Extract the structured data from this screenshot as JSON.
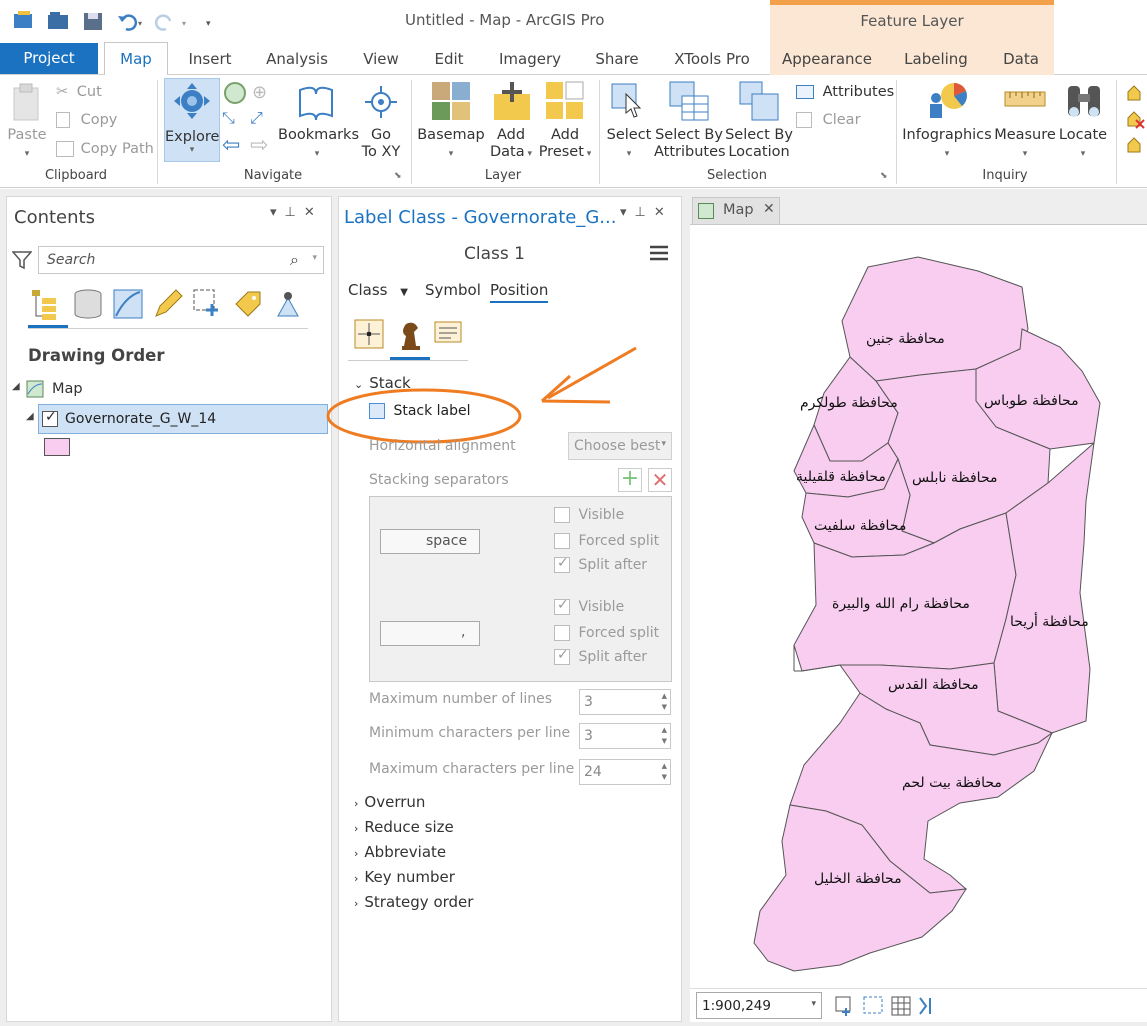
{
  "window": {
    "title": "Untitled - Map - ArcGIS Pro",
    "contextual_header": "Feature Layer"
  },
  "tabs": [
    "Project",
    "Map",
    "Insert",
    "Analysis",
    "View",
    "Edit",
    "Imagery",
    "Share",
    "XTools Pro",
    "Appearance",
    "Labeling",
    "Data"
  ],
  "ribbon": {
    "clipboard": {
      "paste": "Paste",
      "cut": "Cut",
      "copy": "Copy",
      "copy_path": "Copy Path",
      "group": "Clipboard"
    },
    "navigate": {
      "explore": "Explore",
      "bookmarks": "Bookmarks",
      "go_to_xy_1": "Go",
      "go_to_xy_2": "To XY",
      "group": "Navigate"
    },
    "layer": {
      "basemap": "Basemap",
      "add_data_1": "Add",
      "add_data_2": "Data",
      "add_preset_1": "Add",
      "add_preset_2": "Preset",
      "group": "Layer"
    },
    "selection": {
      "select": "Select",
      "by_attr_1": "Select By",
      "by_attr_2": "Attributes",
      "by_loc_1": "Select By",
      "by_loc_2": "Location",
      "attributes": "Attributes",
      "clear": "Clear",
      "group": "Selection"
    },
    "inquiry": {
      "infographics": "Infographics",
      "measure": "Measure",
      "locate": "Locate",
      "group": "Inquiry"
    }
  },
  "contents": {
    "title": "Contents",
    "search_placeholder": "Search",
    "drawing_order": "Drawing Order",
    "map_name": "Map",
    "layer_name": "Governorate_G_W_14"
  },
  "label_class": {
    "title": "Label Class - Governorate_G...",
    "class_name": "Class 1",
    "tabs": [
      "Class",
      "Symbol",
      "Position"
    ],
    "stack_section": "Stack",
    "stack_label": "Stack label",
    "horizontal_alignment": "Horizontal alignment",
    "alignment_value": "Choose best",
    "stacking_separators": "Stacking separators",
    "sep1_value": "space",
    "sep2_value": ",",
    "visible": "Visible",
    "forced_split": "Forced split",
    "split_after": "Split after",
    "max_lines_label": "Maximum number of lines",
    "max_lines": "3",
    "min_chars_label": "Minimum characters per line",
    "min_chars": "3",
    "max_chars_label": "Maximum characters per line",
    "max_chars": "24",
    "collapsed_sections": [
      "Overrun",
      "Reduce size",
      "Abbreviate",
      "Key number",
      "Strategy order"
    ]
  },
  "map": {
    "tab": "Map",
    "scale": "1:900,249",
    "labels": {
      "jenin": "محافظة جنين",
      "tubas": "محافظة طوباس",
      "tulkarm": "محافظة طولكرم",
      "qalqilya": "محافظة قلقيلية",
      "nablus": "محافظة نابلس",
      "salfit": "محافظة سلفيت",
      "ramallah": "محافظة رام الله والبيرة",
      "jericho": "محافظة أريحا",
      "quds": "محافظة القدس",
      "bethlehem": "محافظة بيت لحم",
      "hebron": "محافظة الخليل"
    }
  },
  "colors": {
    "accent": "#1b72c1",
    "polygon_fill": "#f8cdf0",
    "annotation": "#f07c22",
    "ribbon_bg": "#ffffff",
    "chrome_bg": "#eeeeee"
  }
}
